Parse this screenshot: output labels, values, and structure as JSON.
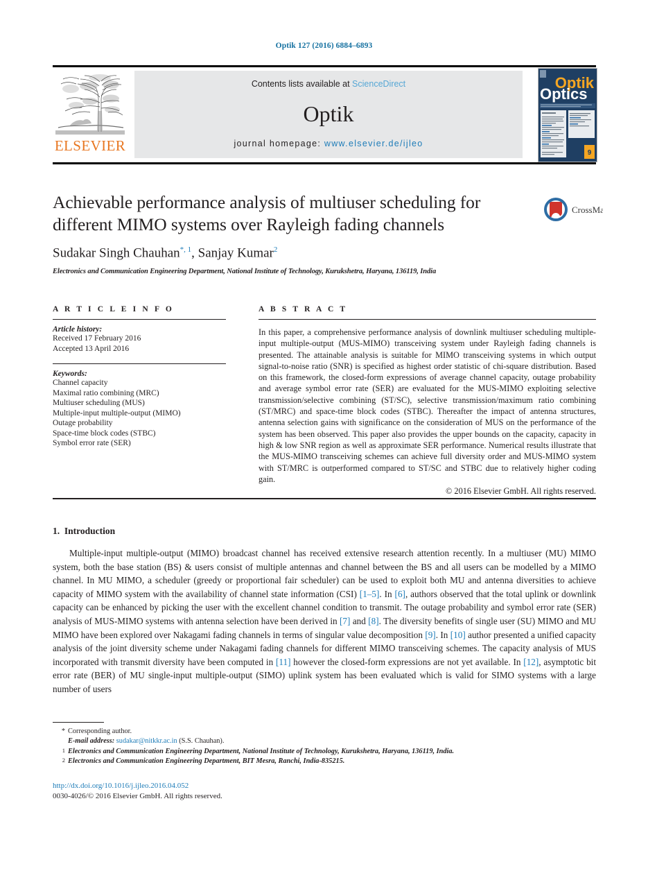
{
  "running_head": "Optik 127 (2016) 6884–6893",
  "masthead": {
    "publisher_name": "ELSEVIER",
    "contents_prefix": "Contents lists available at ",
    "contents_link": "ScienceDirect",
    "journal_name": "Optik",
    "homepage_prefix": "journal homepage: ",
    "homepage_url": "www.elsevier.de/ijleo",
    "cover_title_top": "Optik",
    "cover_title_bottom": "Optics",
    "cover_subtitle": "International Journal for Light and Electron Optics",
    "cover_volume": "9"
  },
  "article": {
    "title": "Achievable performance analysis of multiuser scheduling for different MIMO systems over Rayleigh fading channels",
    "authors": [
      {
        "name": "Sudakar Singh Chauhan",
        "marks": "*, 1"
      },
      {
        "name": "Sanjay Kumar",
        "marks": "2"
      }
    ],
    "affiliation": "Electronics and Communication Engineering Department, National Institute of Technology, Kurukshetra, Haryana, 136119, India",
    "crossmark_label": "CrossMark"
  },
  "article_info": {
    "heading": "A R T I C L E    I N F O",
    "history_label": "Article history:",
    "history": [
      "Received 17 February 2016",
      "Accepted 13 April 2016"
    ],
    "keywords_label": "Keywords:",
    "keywords": [
      "Channel capacity",
      "Maximal ratio combining (MRC)",
      "Multiuser scheduling (MUS)",
      "Multiple-input multiple-output (MIMO)",
      "Outage probability",
      "Space-time block codes (STBC)",
      "Symbol error rate (SER)"
    ]
  },
  "abstract": {
    "heading": "A B S T R A C T",
    "body": "In this paper, a comprehensive performance analysis of downlink multiuser scheduling multiple-input multiple-output (MUS-MIMO) transceiving system under Rayleigh fading channels is presented. The attainable analysis is suitable for MIMO transceiving systems in which output signal-to-noise ratio (SNR) is specified as highest order statistic of chi-square distribution. Based on this framework, the closed-form expressions of average channel capacity, outage probability and average symbol error rate (SER) are evaluated for the MUS-MIMO exploiting selective transmission/selective combining (ST/SC), selective transmission/maximum ratio combining (ST/MRC) and space-time block codes (STBC). Thereafter the impact of antenna structures, antenna selection gains with significance on the consideration of MUS on the performance of the system has been observed. This paper also provides the upper bounds on the capacity, capacity in high & low SNR region as well as approximate SER performance. Numerical results illustrate that the MUS-MIMO transceiving schemes can achieve full diversity order and MUS-MIMO system with ST/MRC is outperformed compared to ST/SC and STBC due to relatively higher coding gain.",
    "copyright": "© 2016 Elsevier GmbH. All rights reserved."
  },
  "introduction": {
    "number": "1.",
    "heading": "Introduction",
    "paragraph_parts": [
      {
        "t": "Multiple-input multiple-output (MIMO) broadcast channel has received extensive research attention recently. In a multiuser (MU) MIMO system, both the base station (BS) & users consist of multiple antennas and channel between the BS and all users can be modelled by a MIMO channel. In MU MIMO, a scheduler (greedy or proportional fair scheduler) can be used to exploit both MU and antenna diversities to achieve capacity of MIMO system with the availability of channel state information (CSI) ",
        "ref": false
      },
      {
        "t": "[1–5]",
        "ref": true
      },
      {
        "t": ". In ",
        "ref": false
      },
      {
        "t": "[6]",
        "ref": true
      },
      {
        "t": ", authors observed that the total uplink or downlink capacity can be enhanced by picking the user with the excellent channel condition to transmit. The outage probability and symbol error rate (SER) analysis of MUS-MIMO systems with antenna selection have been derived in ",
        "ref": false
      },
      {
        "t": "[7]",
        "ref": true
      },
      {
        "t": " and ",
        "ref": false
      },
      {
        "t": "[8]",
        "ref": true
      },
      {
        "t": ". The diversity benefits of single user (SU) MIMO and MU MIMO have been explored over Nakagami fading channels in terms of singular value decomposition ",
        "ref": false
      },
      {
        "t": "[9]",
        "ref": true
      },
      {
        "t": ". In ",
        "ref": false
      },
      {
        "t": "[10]",
        "ref": true
      },
      {
        "t": " author presented a unified capacity analysis of the joint diversity scheme under Nakagami fading channels for different MIMO transceiving schemes. The capacity analysis of MUS incorporated with transmit diversity have been computed in ",
        "ref": false
      },
      {
        "t": "[11]",
        "ref": true
      },
      {
        "t": " however the closed-form expressions are not yet available. In ",
        "ref": false
      },
      {
        "t": "[12]",
        "ref": true
      },
      {
        "t": ", asymptotic bit error rate (BER) of MU single-input multiple-output (SIMO) uplink system has been evaluated which is valid for SIMO systems with a large number of users",
        "ref": false
      }
    ]
  },
  "footnotes": [
    {
      "mark": "*",
      "sup": false,
      "text": "Corresponding author."
    },
    {
      "mark": "",
      "sup": false,
      "label": "E-mail address:",
      "link": "sudakar@nitkkr.ac.in",
      "text": " (S.S. Chauhan)."
    },
    {
      "mark": "1",
      "sup": true,
      "text": "Electronics and Communication Engineering Department, National Institute of Technology, Kurukshetra, Haryana, 136119, India."
    },
    {
      "mark": "2",
      "sup": true,
      "text": "Electronics and Communication Engineering Department, BIT Mesra, Ranchi, India-835215."
    }
  ],
  "doi": {
    "url": "http://dx.doi.org/10.1016/j.ijleo.2016.04.052",
    "issn_line": "0030-4026/© 2016 Elsevier GmbH. All rights reserved."
  },
  "colors": {
    "link_blue": "#1e7cb8",
    "sciencedirect_blue": "#55a7d5",
    "elsevier_orange": "#E87722",
    "panel_gray": "#e6e7e8",
    "text": "#231f20"
  }
}
